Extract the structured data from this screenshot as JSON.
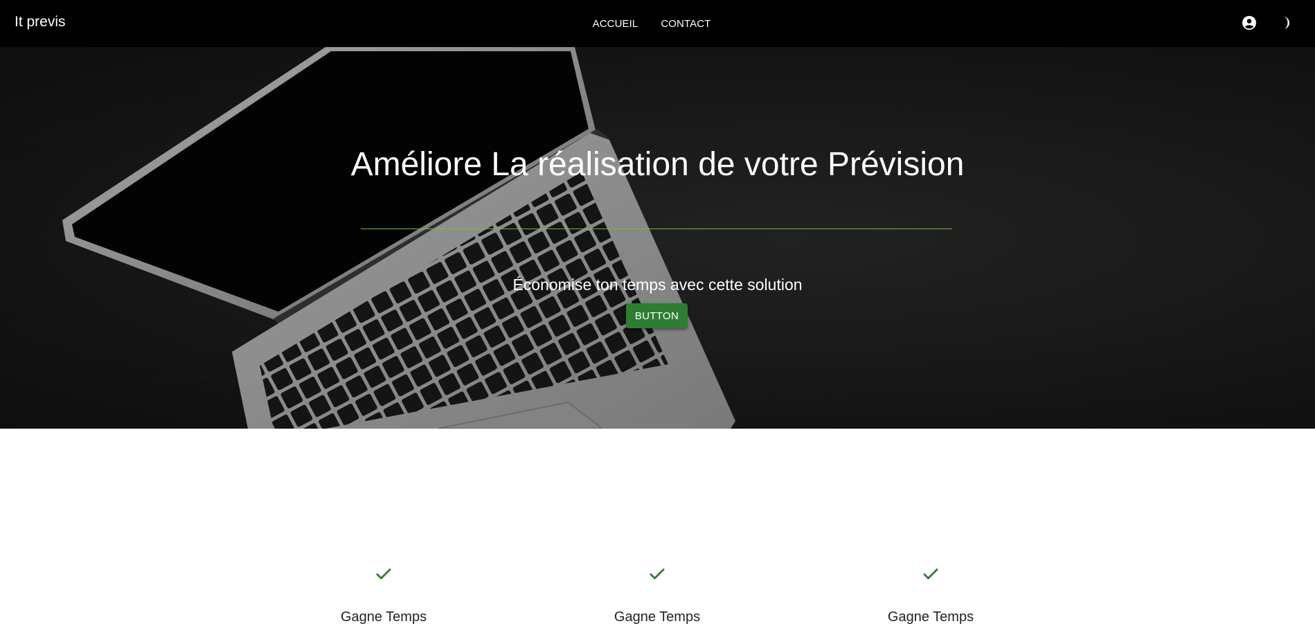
{
  "navbar": {
    "brand": "It previs",
    "links": [
      {
        "label": "ACCUEIL"
      },
      {
        "label": "CONTACT"
      }
    ],
    "icons": [
      "account-circle-icon",
      "dark-mode-icon"
    ]
  },
  "hero": {
    "title": "Améliore La réalisation de votre Prévision",
    "subtitle": "Économise ton temps avec cette solution",
    "button_label": "BUTTON",
    "accent_color": "#6fbf3a",
    "button_color": "#2e7d32"
  },
  "features": [
    {
      "icon": "check-icon",
      "label": "Gagne Temps"
    },
    {
      "icon": "check-icon",
      "label": "Gagne Temps"
    },
    {
      "icon": "check-icon",
      "label": "Gagne Temps"
    }
  ],
  "colors": {
    "navbar_bg": "#000000",
    "check_color": "#2e7d32"
  }
}
